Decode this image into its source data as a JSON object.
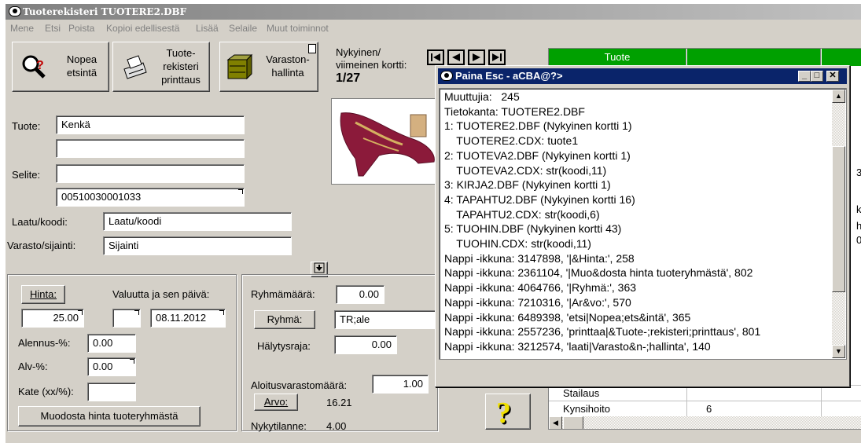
{
  "window": {
    "title": "Tuoterekisteri TUOTERE2.DBF"
  },
  "menu": [
    "Mene",
    "Etsi",
    "Poista",
    "Kopioi edellisestä",
    "Lisää",
    "Selaile",
    "Muut toiminnot"
  ],
  "toolbar": {
    "quick_search": [
      "Nopea",
      "etsintä"
    ],
    "print": [
      "Tuote-",
      "rekisteri",
      "printtaus"
    ],
    "warehouse": [
      "Varaston-",
      "hallinta"
    ]
  },
  "nav": {
    "label1": "Nykyinen/",
    "label2": "viimeinen kortti:",
    "value": "1/27"
  },
  "form": {
    "tuote_label": "Tuote:",
    "tuote_value": "Kenkä",
    "selite_label": "Selite:",
    "code_value": "00510030001033",
    "laatu_label": "Laatu/koodi:",
    "laatu_value": "Laatu/koodi",
    "varasto_label": "Varasto/sijainti:",
    "varasto_value": "Sijainti"
  },
  "price": {
    "hinta_button": "Hinta:",
    "hinta_value": "25.00",
    "valuutta_label": "Valuutta ja sen päivä:",
    "date_value": "08.11.2012",
    "alennus_label": "Alennus-%:",
    "alennus_value": "0.00",
    "alv_label": "Alv-%:",
    "alv_value": "0.00",
    "kate_label": "Kate (xx/%):",
    "form_price_button": "Muodosta hinta tuoteryhmästä"
  },
  "group": {
    "ryhmamaara_label": "Ryhmämäärä:",
    "ryhmamaara_value": "0.00",
    "ryhma_button": "Ryhmä:",
    "ryhma_value": "TR;ale",
    "halytysraja_label": "Hälytysraja:",
    "halytysraja_value": "0.00",
    "aloitus_label": "Aloitusvarastomäärä:",
    "aloitus_value": "1.00",
    "arvo_button": "Arvo:",
    "arvo_value": "16.21",
    "nykytilanne_label": "Nykytilanne:",
    "nykytilanne_value": "4.00"
  },
  "grid": {
    "header": "Tuote",
    "rows": [
      {
        "name": "Stailaus",
        "value": ""
      },
      {
        "name": "Kynsihoito",
        "value": "6"
      }
    ],
    "clipped_chars": [
      "3",
      "k",
      "h",
      "0"
    ]
  },
  "popup": {
    "title": "Paina Esc - aCBA@?>",
    "lines": [
      "Muuttujia:   245",
      "Tietokanta: TUOTERE2.DBF",
      "1: TUOTERE2.DBF (Nykyinen kortti 1)",
      "    TUOTERE2.CDX: tuote1",
      "2: TUOTEVA2.DBF (Nykyinen kortti 1)",
      "    TUOTEVA2.CDX: str(koodi,11)",
      "3: KIRJA2.DBF (Nykyinen kortti 1)",
      "4: TAPAHTU2.DBF (Nykyinen kortti 16)",
      "    TAPAHTU2.CDX: str(koodi,6)",
      "5: TUOHIN.DBF (Nykyinen kortti 43)",
      "    TUOHIN.CDX: str(koodi,11)",
      "Nappi -ikkuna: 3147898, '|&Hinta:', 258",
      "Nappi -ikkuna: 2361104, '|Muo&dosta hinta tuoteryhmästä', 802",
      "Nappi -ikkuna: 4064766, '|Ryhmä:', 363",
      "Nappi -ikkuna: 7210316, '|Ar&vo:', 570",
      "Nappi -ikkuna: 6489398, 'etsi|Nopea;ets&intä', 365",
      "Nappi -ikkuna: 2557236, 'printtaa|&Tuote-;rekisteri;printtaus', 801",
      "Nappi -ikkuna: 3212574, 'laati|Varasto&n-;hallinta', 140"
    ]
  },
  "colors": {
    "grid_header": "#00a000",
    "popup_title": "#0a246a"
  }
}
